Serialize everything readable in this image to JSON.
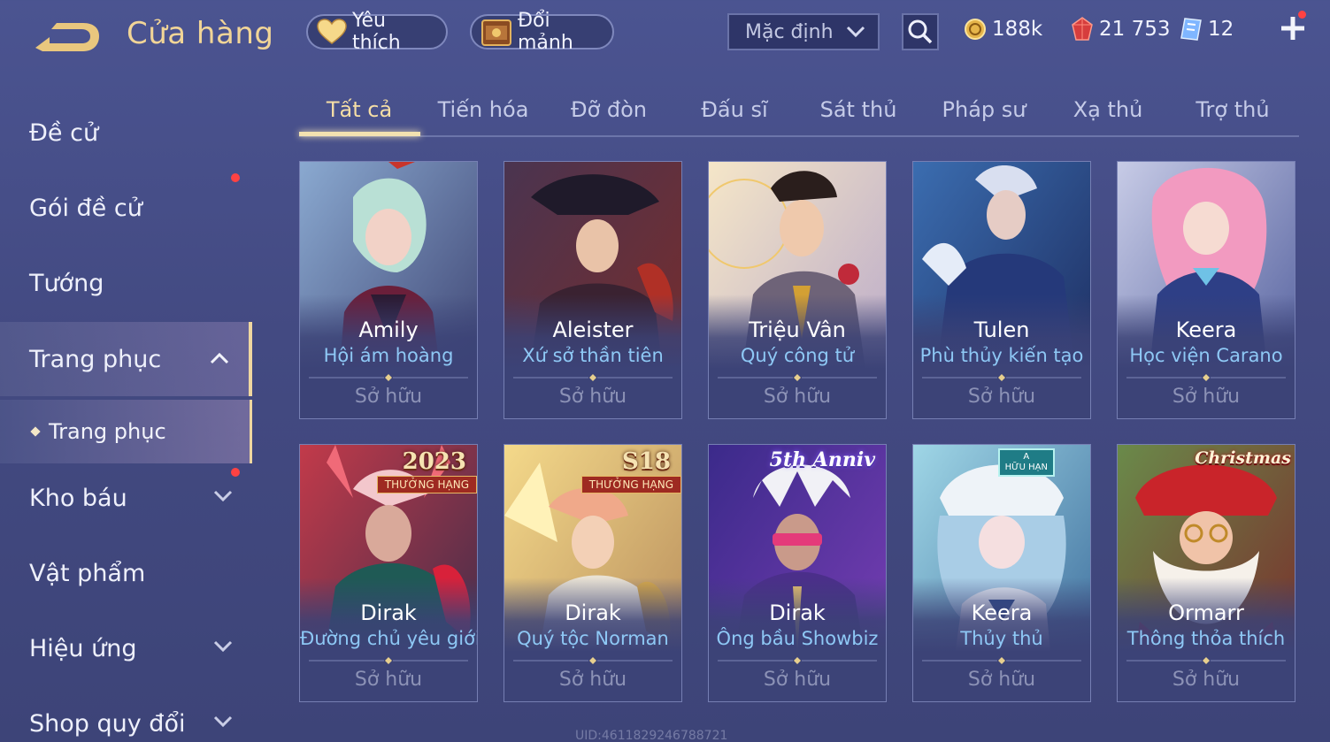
{
  "header": {
    "title": "Cửa hàng",
    "favorites_label": "Yêu thích",
    "fragments_label": "Đổi mảnh",
    "sort_value": "Mặc định"
  },
  "currencies": {
    "gold": "188k",
    "ruby": "21 753",
    "voucher": "12"
  },
  "sidebar": {
    "items": [
      {
        "label": "Đề cử"
      },
      {
        "label": "Gói đề cử"
      },
      {
        "label": "Tướng"
      },
      {
        "label": "Trang phục"
      },
      {
        "label": "Kho báu"
      },
      {
        "label": "Vật phẩm"
      },
      {
        "label": "Hiệu ứng"
      },
      {
        "label": "Shop quy đổi"
      }
    ],
    "sub_item": "Trang phục"
  },
  "tabs": [
    "Tất cả",
    "Tiến hóa",
    "Đỡ đòn",
    "Đấu sĩ",
    "Sát thủ",
    "Pháp sư",
    "Xạ thủ",
    "Trợ thủ"
  ],
  "cards": [
    {
      "hero": "Amily",
      "skin": "Hội ám hoàng",
      "status": "Sở hữu"
    },
    {
      "hero": "Aleister",
      "skin": "Xứ sở thần tiên",
      "status": "Sở hữu"
    },
    {
      "hero": "Triệu Vân",
      "skin": "Quý công tử",
      "status": "Sở hữu"
    },
    {
      "hero": "Tulen",
      "skin": "Phù thủy kiến tạo",
      "status": "Sở hữu"
    },
    {
      "hero": "Keera",
      "skin": "Học viện Carano",
      "status": "Sở hữu"
    },
    {
      "hero": "Dirak",
      "skin": "Đường chủ yêu giới",
      "status": "Sở hữu",
      "badge_big": "2023",
      "badge_small": "THƯỞNG HẠNG"
    },
    {
      "hero": "Dirak",
      "skin": "Quý tộc Norman",
      "status": "Sở hữu",
      "badge_big": "S18",
      "badge_small": "THƯỞNG HẠNG"
    },
    {
      "hero": "Dirak",
      "skin": "Ông bầu Showbiz",
      "status": "Sở hữu",
      "badge_big": "5th Anniv"
    },
    {
      "hero": "Keera",
      "skin": "Thủy thủ",
      "status": "Sở hữu",
      "badge_big": "A",
      "badge_small": "HỮU HẠN"
    },
    {
      "hero": "Ormarr",
      "skin": "Thông thỏa thích",
      "status": "Sở hữu",
      "badge_big": "Christmas"
    }
  ],
  "footer": {
    "uid": "UID:4611829246788721"
  },
  "colors": {
    "accent_gold": "#f1d597",
    "skin_blue": "#8ec8f5",
    "notification_red": "#ff4242"
  }
}
